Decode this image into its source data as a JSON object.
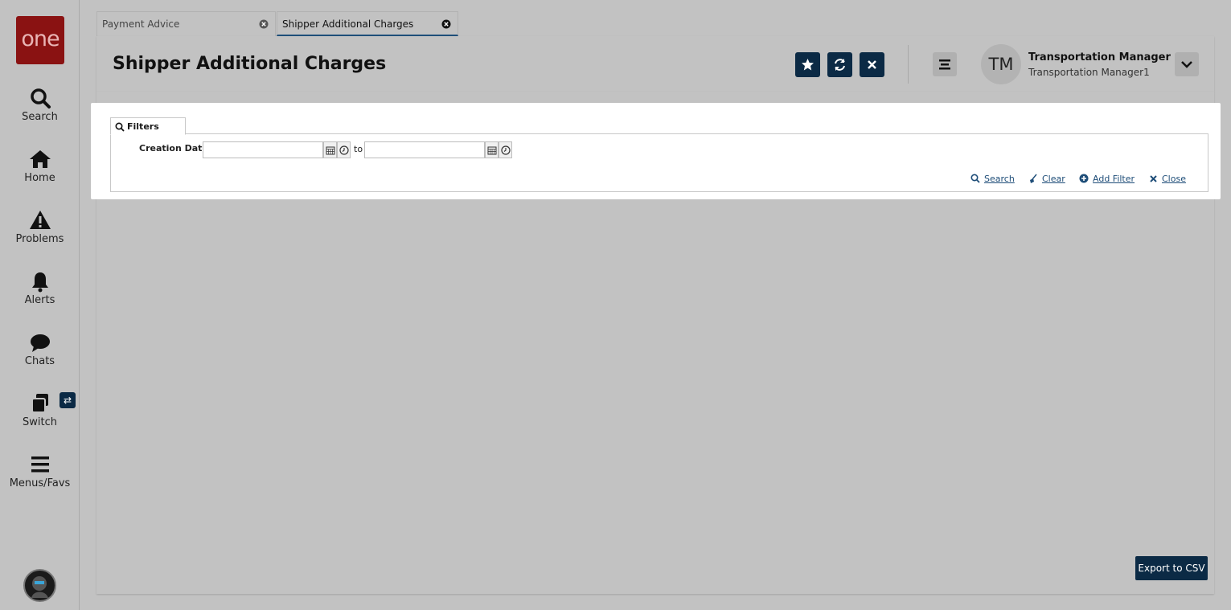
{
  "brand": {
    "logo_text": "one",
    "logo_color": "#8a1212"
  },
  "sidebar": {
    "items": [
      {
        "label": "Search",
        "icon": "search-icon"
      },
      {
        "label": "Home",
        "icon": "home-icon"
      },
      {
        "label": "Problems",
        "icon": "warning-icon"
      },
      {
        "label": "Alerts",
        "icon": "bell-icon"
      },
      {
        "label": "Chats",
        "icon": "chat-icon"
      },
      {
        "label": "Switch",
        "icon": "switch-icon",
        "badge": "⇄"
      },
      {
        "label": "Menus/Favs",
        "icon": "menu-icon"
      }
    ]
  },
  "tabs": [
    {
      "label": "Payment Advice",
      "active": false
    },
    {
      "label": "Shipper Additional Charges",
      "active": true
    }
  ],
  "header": {
    "title": "Shipper Additional Charges",
    "user": {
      "initials": "TM",
      "name": "Transportation Manager",
      "sub": "Transportation Manager1"
    }
  },
  "filters": {
    "tab_label": "Filters",
    "creation_date_label": "Creation Date:",
    "from_value": "",
    "to_label": "to",
    "to_value": "",
    "actions": {
      "search": "Search",
      "clear": "Clear",
      "add_filter": "Add Filter",
      "close": "Close"
    }
  },
  "export_label": "Export to CSV",
  "colors": {
    "accent": "#0b2a45",
    "link": "#1e4d78",
    "background": "#c2c2c2"
  }
}
